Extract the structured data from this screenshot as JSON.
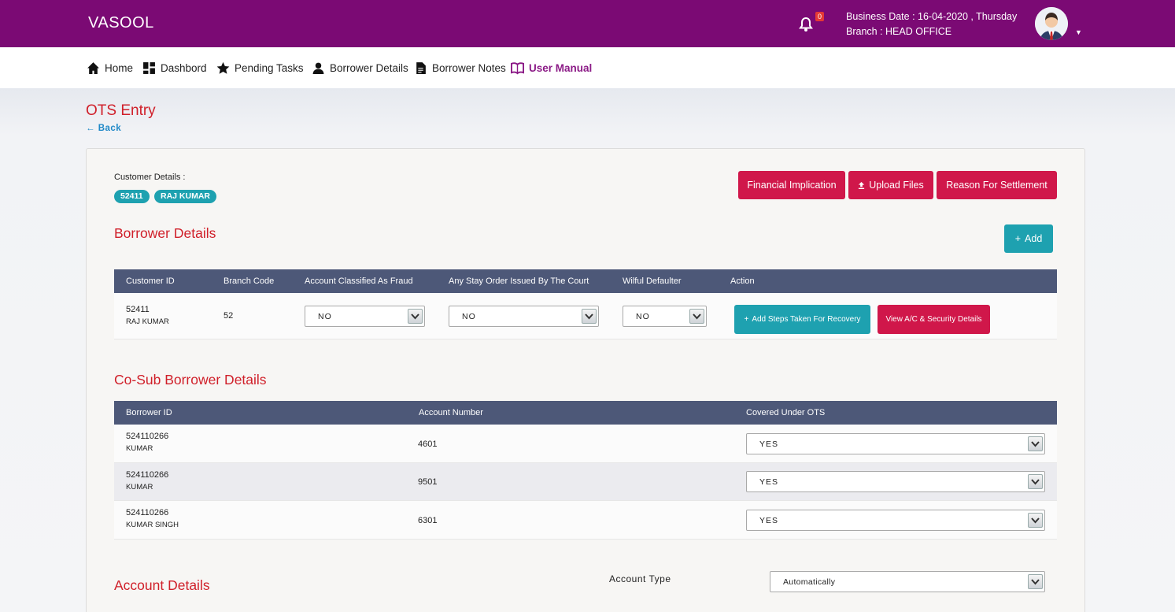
{
  "app": {
    "brand": "VASOOL",
    "notifications": "0",
    "business_date": "Business Date : 16-04-2020 , Thursday",
    "branch": "Branch : HEAD OFFICE"
  },
  "nav": [
    {
      "label": "Home",
      "icon": "home-icon"
    },
    {
      "label": "Dashbord",
      "icon": "dashboard-icon"
    },
    {
      "label": "Pending Tasks",
      "icon": "star-icon"
    },
    {
      "label": "Borrower Details",
      "icon": "user-icon"
    },
    {
      "label": "Borrower Notes",
      "icon": "document-icon"
    },
    {
      "label": "User Manual",
      "icon": "book-icon"
    }
  ],
  "page": {
    "title": "OTS Entry",
    "back": "Back"
  },
  "customer": {
    "label": "Customer Details :",
    "id": "52411",
    "name": "RAJ KUMAR"
  },
  "actions": {
    "financial": "Financial Implication",
    "upload": "Upload Files",
    "reason": "Reason For Settlement",
    "add": "Add"
  },
  "borrower": {
    "title": "Borrower Details",
    "headers": [
      "Customer ID",
      "Branch Code",
      "Account Classified As Fraud",
      "Any Stay Order Issued By The Court",
      "Wilful Defaulter",
      "Action"
    ],
    "row": {
      "id": "52411",
      "name": "RAJ KUMAR",
      "branch_code": "52",
      "fraud": "NO",
      "stay_order": "NO",
      "wilful": "NO",
      "btn_steps": "Add Steps Taken For Recovery",
      "btn_view": "View A/C & Security Details"
    }
  },
  "co_sub": {
    "title": "Co-Sub Borrower Details",
    "headers": [
      "Borrower ID",
      "Account Number",
      "Covered Under OTS"
    ],
    "rows": [
      {
        "id": "524110266",
        "name": "KUMAR",
        "account": "4601",
        "covered": "YES"
      },
      {
        "id": "524110266",
        "name": "KUMAR",
        "account": "9501",
        "covered": "YES"
      },
      {
        "id": "524110266",
        "name": "KUMAR SINGH",
        "account": "6301",
        "covered": "YES"
      }
    ]
  },
  "account": {
    "title": "Account Details",
    "type_label": "Account Type",
    "type_value": "Automatically"
  },
  "colors": {
    "brand": "#7b0a74",
    "accent_red": "#d0174a",
    "accent_teal": "#1ea1b0",
    "table_header": "#4d5878"
  }
}
